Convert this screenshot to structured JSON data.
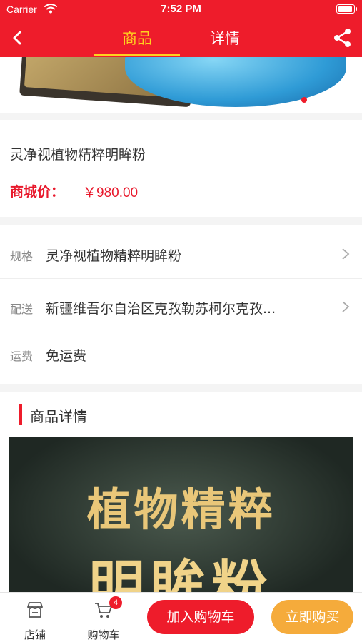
{
  "status_bar": {
    "carrier": "Carrier",
    "time": "7:52 PM"
  },
  "nav": {
    "tabs": [
      {
        "label": "商品"
      },
      {
        "label": "详情"
      }
    ]
  },
  "product": {
    "title": "灵净视植物精粹明眸粉",
    "price_label": "商城价：",
    "price": "￥980.00"
  },
  "specs": {
    "spec": {
      "label": "规格",
      "value": "灵净视植物精粹明眸粉"
    },
    "delivery": {
      "label": "配送",
      "value": "新疆维吾尔自治区克孜勒苏柯尔克孜..."
    },
    "shipping": {
      "label": "运费",
      "value": "免运费"
    }
  },
  "detail": {
    "title": "商品详情",
    "image_line1": "植物精粹",
    "image_line2": "明眸粉"
  },
  "bottom": {
    "store_label": "店铺",
    "cart_label": "购物车",
    "cart_count": "4",
    "add_to_cart": "加入购物车",
    "buy_now": "立即购买"
  },
  "colors": {
    "brand_red": "#ee1c2b",
    "tab_active": "#ffd21f",
    "price_red": "#e8192c",
    "buy_orange": "#f5ab3b"
  },
  "icons": [
    "wifi-icon",
    "battery-icon",
    "back-arrow-icon",
    "share-icon",
    "chevron-right-icon",
    "store-icon",
    "cart-icon"
  ]
}
